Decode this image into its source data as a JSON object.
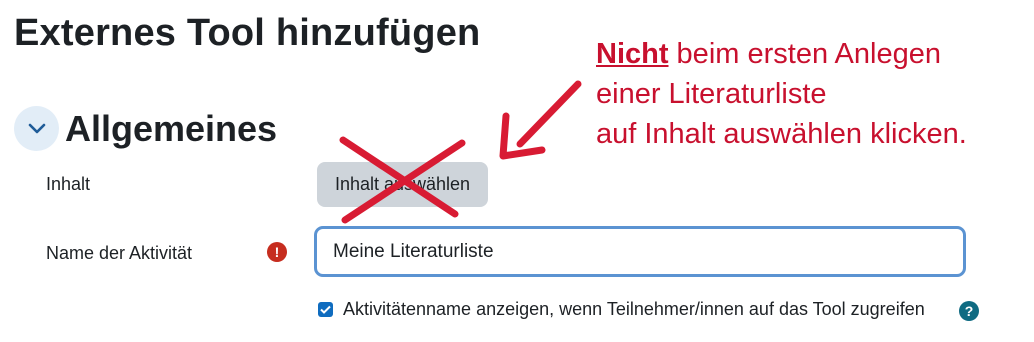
{
  "page": {
    "title": "Externes Tool hinzufügen"
  },
  "section": {
    "title": "Allgemeines",
    "toggle_icon": "chevron-down-icon"
  },
  "fields": {
    "content": {
      "label": "Inhalt",
      "button_label": "Inhalt auswählen"
    },
    "name": {
      "label": "Name der Aktivität",
      "value": "Meine Literaturliste",
      "required_icon": "!"
    },
    "show_name": {
      "label": "Aktivitätenname anzeigen, wenn Teilnehmer/innen auf das Tool zugreifen",
      "checked": true,
      "help_icon": "?"
    }
  },
  "annotation": {
    "emphasis": "Nicht",
    "line1_rest": " beim ersten Anlegen",
    "line2": "einer Literaturliste",
    "line3": "auf Inhalt auswählen klicken.",
    "color": "#c8102e"
  },
  "colors": {
    "accent": "#0f6cbf",
    "required": "#c62d1f",
    "help": "#0f6b82",
    "focus_border": "#5b93d2"
  }
}
